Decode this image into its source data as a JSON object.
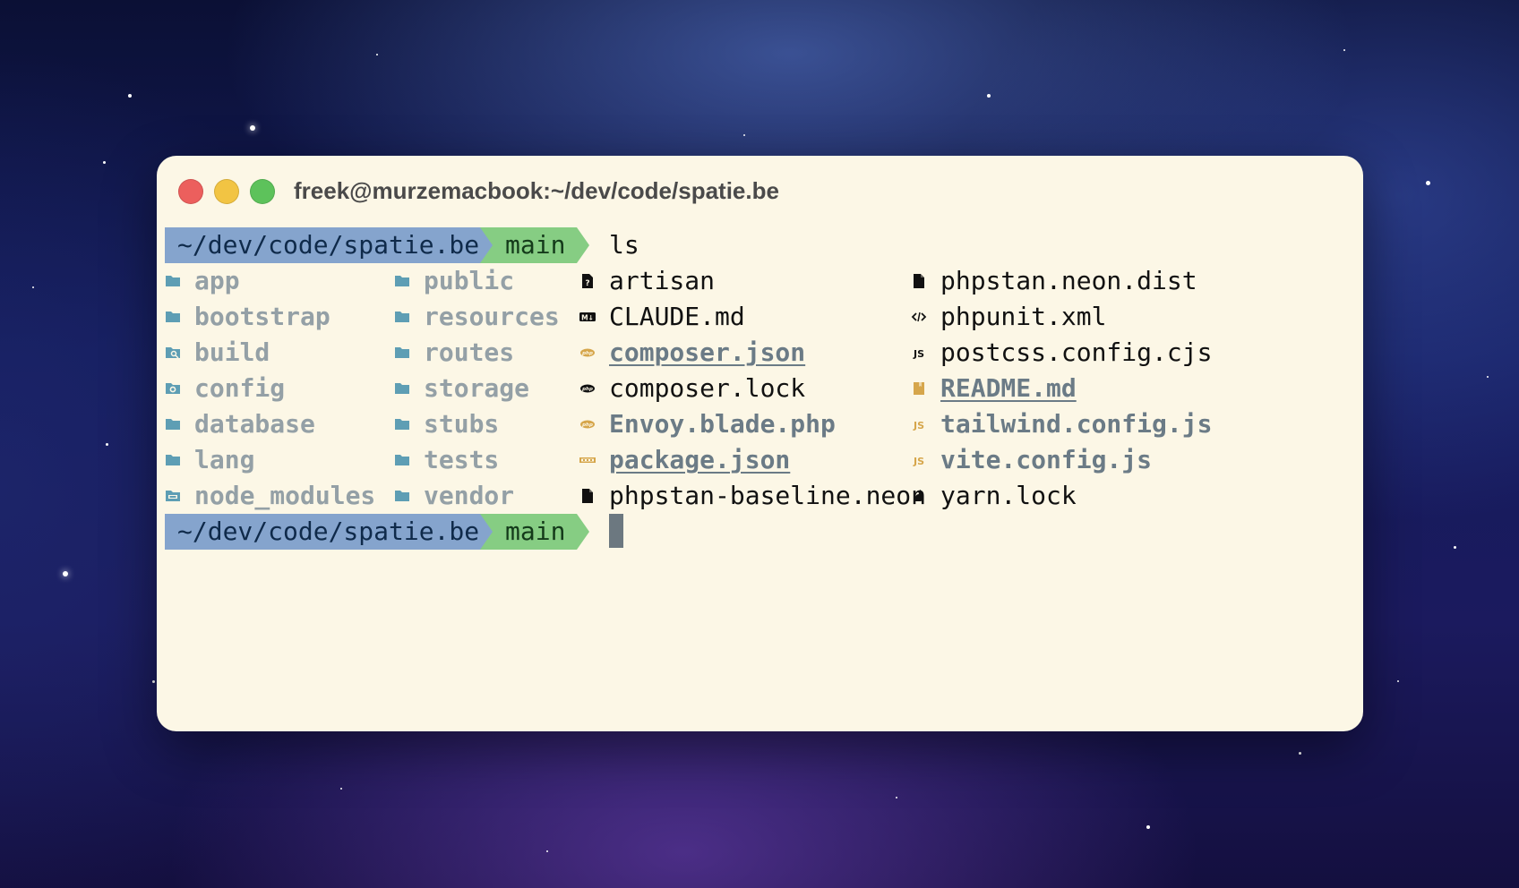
{
  "window": {
    "title": "freek@murzemacbook:~/dev/code/spatie.be"
  },
  "colors": {
    "window_bg": "#fcf7e6",
    "path_segment": "#85a4cd",
    "branch_segment": "#86cd83",
    "directory_icon": "#5e9eb4",
    "json_icon": "#d6a64b"
  },
  "prompt1": {
    "path": "~/dev/code/spatie.be",
    "branch": "main",
    "command": "ls"
  },
  "prompt2": {
    "path": "~/dev/code/spatie.be",
    "branch": "main"
  },
  "listing": {
    "col1": [
      {
        "name": "app",
        "icon": "folder-icon"
      },
      {
        "name": "bootstrap",
        "icon": "folder-icon"
      },
      {
        "name": "build",
        "icon": "folder-search-icon"
      },
      {
        "name": "config",
        "icon": "folder-gear-icon"
      },
      {
        "name": "database",
        "icon": "folder-icon"
      },
      {
        "name": "lang",
        "icon": "folder-icon"
      },
      {
        "name": "node_modules",
        "icon": "folder-npm-icon"
      }
    ],
    "col2": [
      {
        "name": "public",
        "icon": "folder-icon"
      },
      {
        "name": "resources",
        "icon": "folder-icon"
      },
      {
        "name": "routes",
        "icon": "folder-icon"
      },
      {
        "name": "storage",
        "icon": "folder-icon"
      },
      {
        "name": "stubs",
        "icon": "folder-icon"
      },
      {
        "name": "tests",
        "icon": "folder-icon"
      },
      {
        "name": "vendor",
        "icon": "folder-icon"
      }
    ],
    "col3": [
      {
        "name": "artisan",
        "icon": "file-unknown-icon"
      },
      {
        "name": "CLAUDE.md",
        "icon": "markdown-icon"
      },
      {
        "name": "composer.json",
        "icon": "php-icon"
      },
      {
        "name": "composer.lock",
        "icon": "php-icon"
      },
      {
        "name": "Envoy.blade.php",
        "icon": "php-icon"
      },
      {
        "name": "package.json",
        "icon": "npm-icon"
      },
      {
        "name": "phpstan-baseline.neon",
        "icon": "file-icon"
      }
    ],
    "col4": [
      {
        "name": "phpstan.neon.dist",
        "icon": "file-icon"
      },
      {
        "name": "phpunit.xml",
        "icon": "code-icon"
      },
      {
        "name": "postcss.config.cjs",
        "icon": "js-icon"
      },
      {
        "name": "README.md",
        "icon": "book-icon"
      },
      {
        "name": "tailwind.config.js",
        "icon": "js-icon"
      },
      {
        "name": "vite.config.js",
        "icon": "js-icon"
      },
      {
        "name": "yarn.lock",
        "icon": "yarn-icon"
      }
    ]
  }
}
